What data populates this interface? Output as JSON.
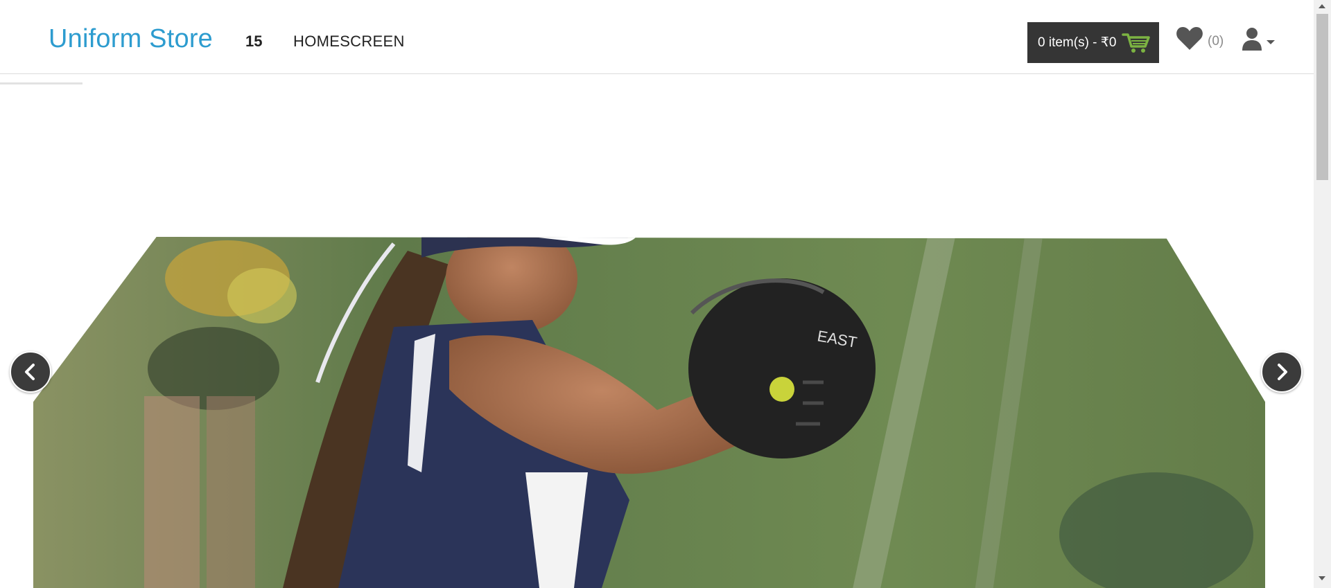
{
  "header": {
    "brand": "Uniform Store",
    "nav": {
      "number": "15",
      "home": "HOMESCREEN"
    },
    "cart": {
      "label": "0 item(s) - ₹0",
      "icon": "cart-icon",
      "icon_color": "#7cb342"
    },
    "wishlist": {
      "count": "(0)",
      "icon": "heart-icon"
    },
    "account": {
      "icon": "user-icon",
      "dropdown_icon": "caret-down-icon"
    }
  },
  "slider": {
    "prev_icon": "chevron-left-icon",
    "next_icon": "chevron-right-icon",
    "image_subject": "softball-pitcher-photo"
  },
  "colors": {
    "brand": "#2d9ccf",
    "cart_bg": "#353535",
    "arrow_bg": "#3b3b3b"
  }
}
